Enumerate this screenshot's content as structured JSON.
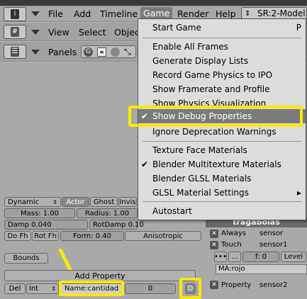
{
  "header": {
    "menus": [
      "File",
      "Add",
      "Timeline",
      "Game",
      "Render",
      "Help"
    ],
    "scene": "SR:2-Model"
  },
  "toolbar2": {
    "items": [
      "View",
      "Select",
      "Objec"
    ]
  },
  "toolbar3": {
    "label": "Panels"
  },
  "game_menu": {
    "items": [
      {
        "label": "Start Game",
        "shortcut": "P"
      },
      {
        "label": "Enable All Frames"
      },
      {
        "label": "Generate Display Lists"
      },
      {
        "label": "Record Game Physics to IPO"
      },
      {
        "label": "Show Framerate and Profile"
      },
      {
        "label": "Show Physics Visualization"
      },
      {
        "label": "Show Debug Properties",
        "checked": "✔"
      },
      {
        "label": "Ignore Deprecation Warnings"
      },
      {
        "label": "Texture Face Materials"
      },
      {
        "label": "Blender Multitexture Materials",
        "checked": "✔"
      },
      {
        "label": "Blender GLSL Materials"
      },
      {
        "label": "GLSL Material Settings",
        "submenu": "▸"
      },
      {
        "label": "Autostart"
      }
    ]
  },
  "physics": {
    "type": "Dynamic",
    "actor": "Actor",
    "ghost": "Ghost",
    "invis": "Invis",
    "mass": "Mass: 1.00",
    "radius": "Radius: 1.00",
    "damp": "Damp 0.040",
    "rotdamp": "RotDamp 0.10",
    "dofh": "Do Fh",
    "rotfh": "Rot Fh",
    "form": "Form: 0.40",
    "anisotropic": "Anisotropic"
  },
  "bounds_label": "Bounds",
  "add_property": "Add Property",
  "property_row": {
    "del": "Del",
    "type": "Int",
    "name": "Name:cantidad",
    "value": "0",
    "debug": "D"
  },
  "logic": {
    "object_name": "tragabolas",
    "sensors": [
      {
        "type": "Always",
        "name": "sensor"
      },
      {
        "type": "Touch",
        "name": "sensor1"
      }
    ],
    "freq": "f: 0",
    "level": "Level",
    "material": "MA:rojo",
    "property_sensor": {
      "type": "Property",
      "name": "sensor2"
    },
    "close_glyph": "✕"
  }
}
